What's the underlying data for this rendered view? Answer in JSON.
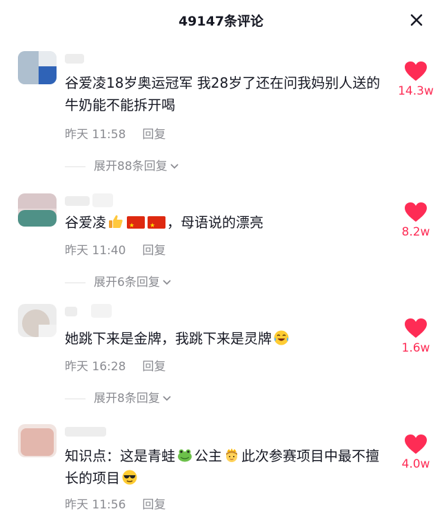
{
  "header": {
    "title": "49147条评论",
    "close_icon": "close-icon"
  },
  "comments": [
    {
      "segments": [
        {
          "t": "text",
          "v": "谷爱凌18岁奥运冠军 我28岁了还在问我妈别人送的牛奶能不能拆开喝"
        }
      ],
      "time": "昨天 11:58",
      "reply": "回复",
      "expand": "展开88条回复",
      "likes": "14.3w"
    },
    {
      "segments": [
        {
          "t": "text",
          "v": "谷爱凌"
        },
        {
          "t": "icon",
          "v": "thumbs-up-emoji"
        },
        {
          "t": "icon",
          "v": "china-flag-emoji"
        },
        {
          "t": "icon",
          "v": "china-flag-emoji"
        },
        {
          "t": "text",
          "v": "，母语说的漂亮"
        }
      ],
      "time": "昨天 11:40",
      "reply": "回复",
      "expand": "展开6条回复",
      "likes": "8.2w"
    },
    {
      "segments": [
        {
          "t": "text",
          "v": "她跳下来是金牌，我跳下来是灵牌"
        },
        {
          "t": "icon",
          "v": "crying-laughing-emoji"
        }
      ],
      "time": "昨天 16:28",
      "reply": "回复",
      "expand": "展开8条回复",
      "likes": "1.6w"
    },
    {
      "segments": [
        {
          "t": "text",
          "v": "知识点：这是青蛙"
        },
        {
          "t": "icon",
          "v": "frog-emoji"
        },
        {
          "t": "text",
          "v": "公主"
        },
        {
          "t": "icon",
          "v": "princess-emoji"
        },
        {
          "t": "text",
          "v": "此次参赛项目中最不擅长的项目"
        },
        {
          "t": "icon",
          "v": "sunglasses-emoji"
        }
      ],
      "time": "昨天 11:56",
      "reply": "回复",
      "likes": "4.0w"
    }
  ],
  "colors": {
    "like": "#fe2c55",
    "meta": "#8a8b91",
    "text": "#161823"
  }
}
